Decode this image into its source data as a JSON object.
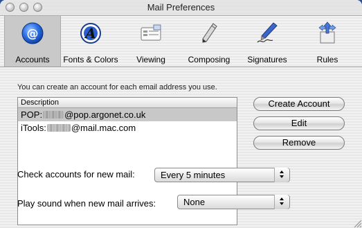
{
  "window": {
    "title": "Mail Preferences"
  },
  "toolbar": {
    "items": [
      {
        "label": "Accounts",
        "icon": "at-sign-icon",
        "selected": true
      },
      {
        "label": "Fonts & Colors",
        "icon": "font-a-icon",
        "selected": false
      },
      {
        "label": "Viewing",
        "icon": "viewing-icon",
        "selected": false
      },
      {
        "label": "Composing",
        "icon": "pencil-icon",
        "selected": false
      },
      {
        "label": "Signatures",
        "icon": "pen-signature-icon",
        "selected": false
      },
      {
        "label": "Rules",
        "icon": "rules-arrows-icon",
        "selected": false
      }
    ]
  },
  "accounts": {
    "hint": "You can create an account for each email address you use.",
    "column_header": "Description",
    "rows": [
      {
        "prefix": "POP:",
        "suffix": "@pop.argonet.co.uk",
        "selected": true
      },
      {
        "prefix": "iTools:",
        "suffix": "@mail.mac.com",
        "selected": false
      }
    ],
    "buttons": {
      "create": "Create Account",
      "edit": "Edit",
      "remove": "Remove"
    }
  },
  "check_mail": {
    "label": "Check accounts for new mail:",
    "value": "Every 5 minutes"
  },
  "sound": {
    "label": "Play sound when new mail arrives:",
    "value": "None"
  },
  "colors": {
    "desktop": "#2a4f97",
    "at_icon_blue": "#1b5fd6"
  }
}
